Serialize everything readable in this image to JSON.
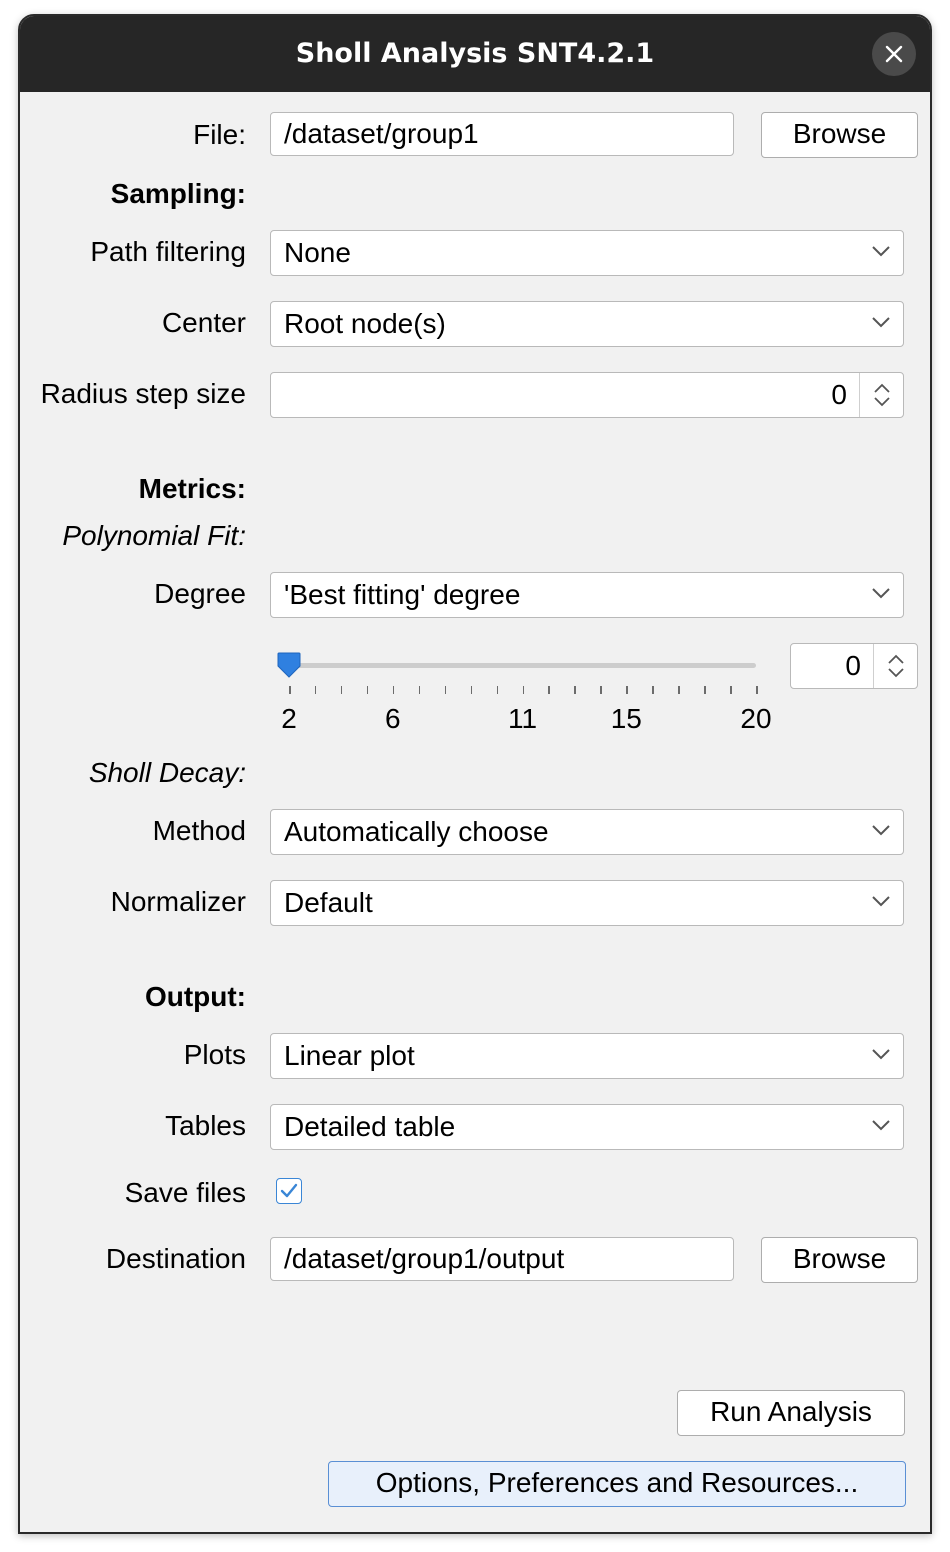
{
  "window": {
    "title": "Sholl Analysis SNT4.2.1"
  },
  "file": {
    "label": "File:",
    "value": "/dataset/group1",
    "browse_label": "Browse"
  },
  "sampling": {
    "heading": "Sampling:",
    "path_filtering": {
      "label": "Path filtering",
      "value": "None"
    },
    "center": {
      "label": "Center",
      "value": "Root node(s)"
    },
    "radius_step": {
      "label": "Radius step size",
      "value": "0"
    }
  },
  "metrics": {
    "heading": "Metrics:",
    "polynomial_fit": {
      "subheading": "Polynomial Fit:",
      "degree": {
        "label": "Degree",
        "value": "'Best fitting' degree"
      },
      "slider": {
        "value": 2,
        "min": 2,
        "max": 20,
        "tick_labels": [
          "2",
          "6",
          "11",
          "15",
          "20"
        ],
        "spinner_value": "0"
      }
    },
    "sholl_decay": {
      "subheading": "Sholl Decay:",
      "method": {
        "label": "Method",
        "value": "Automatically choose"
      },
      "normalizer": {
        "label": "Normalizer",
        "value": "Default"
      }
    }
  },
  "output": {
    "heading": "Output:",
    "plots": {
      "label": "Plots",
      "value": "Linear plot"
    },
    "tables": {
      "label": "Tables",
      "value": "Detailed table"
    },
    "save_files": {
      "label": "Save files",
      "checked": true
    },
    "destination": {
      "label": "Destination",
      "value": "/dataset/group1/output",
      "browse_label": "Browse"
    }
  },
  "actions": {
    "run_label": "Run Analysis",
    "options_label": "Options, Preferences and Resources..."
  },
  "colors": {
    "accent": "#3a86d6",
    "titlebar": "#262626"
  }
}
